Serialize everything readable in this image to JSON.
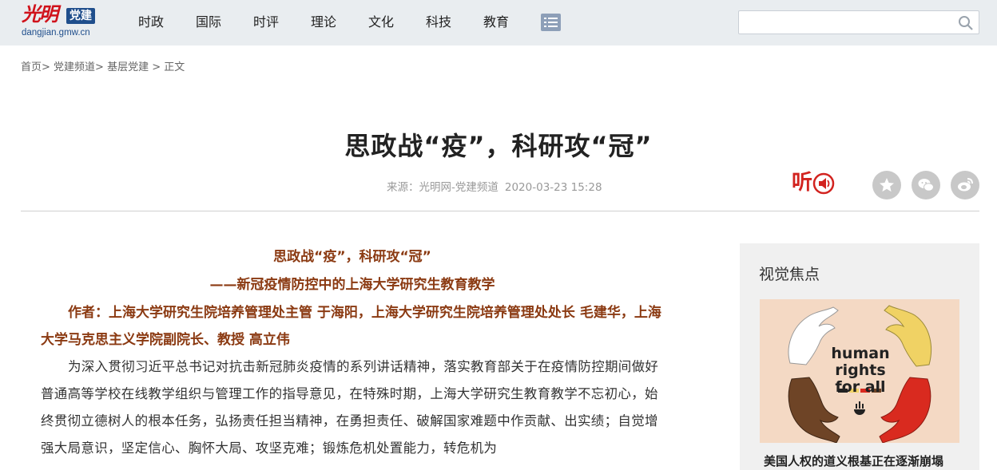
{
  "header": {
    "logo_brush": "光明",
    "logo_badge": "党建",
    "logo_domain": "dangjian.gmw.cn",
    "nav": [
      "时政",
      "国际",
      "时评",
      "理论",
      "文化",
      "科技",
      "教育"
    ],
    "search": {
      "placeholder": "",
      "value": ""
    }
  },
  "breadcrumb": [
    "首页>",
    "党建频道>",
    "基层党建",
    ">",
    "正文"
  ],
  "article": {
    "title": "思政战“疫”，科研攻“冠”",
    "source": "来源：光明网-党建频道",
    "date": "2020-03-23 15:28",
    "listen_label": "听",
    "subtitle_1": "思政战“疫”，科研攻“冠”",
    "subtitle_2": "——新冠疫情防控中的上海大学研究生教育教学",
    "authors": "作者：上海大学研究生院培养管理处主管 于海阳，上海大学研究生院培养管理处处长 毛建华，上海大学马克思主义学院副院长、教授 高立伟",
    "paragraph_1": "为深入贯彻习近平总书记对抗击新冠肺炎疫情的系列讲话精神，落实教育部关于在疫情防控期间做好普通高等学校在线教学组织与管理工作的指导意见，在特殊时期，上海大学研究生教育教学不忘初心，始终贯彻立德树人的根本任务，弘扬责任担当精神，在勇担责任、破解国家难题中作贡献、出实绩；自觉增强大局意识，坚定信心、胸怀大局、攻坚克难；锻炼危机处置能力，转危机为"
  },
  "share_icons": [
    "share-icon",
    "wechat-icon",
    "weibo-icon"
  ],
  "sidebar": {
    "title": "视觉焦点",
    "image_text": [
      "human",
      "rights",
      "for all"
    ],
    "caption": "美国人权的道义根基正在逐渐崩塌"
  },
  "colors": {
    "accent_red": "#d2231f",
    "article_brown": "#8b3a12",
    "nav_bg": "#e9edf0"
  }
}
